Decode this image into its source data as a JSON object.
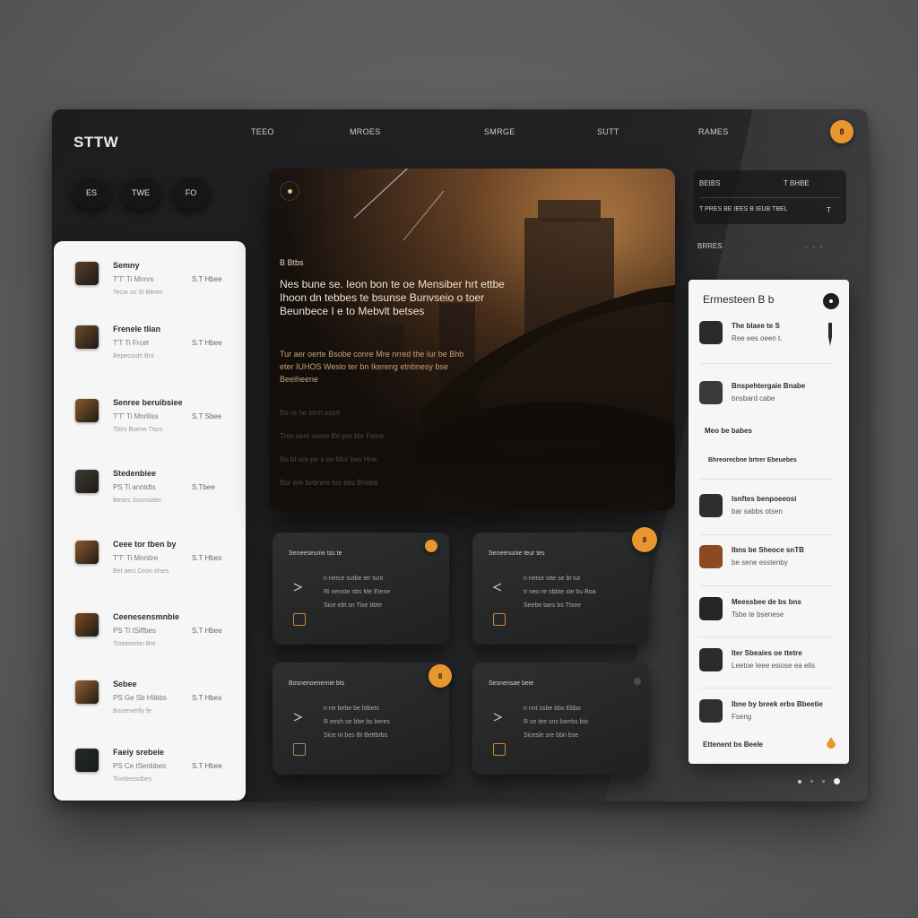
{
  "app": {
    "brand": "STTW"
  },
  "nav": [
    "TEEO",
    "MROES",
    "SMRGE",
    "SUTT",
    "RAMES"
  ],
  "notify_badge": "8",
  "pills": [
    "ES",
    "TWE",
    "FO"
  ],
  "left_list": [
    {
      "title": "Semny",
      "meta": "T'T' Ti Mnrvs",
      "value": "S.T Hbee",
      "sub": "Tecar oc Si Biines",
      "color": "#5a3f2a"
    },
    {
      "title": "Frenele tlian",
      "meta": "T'T Ti Frcet",
      "value": "S.T Hbee",
      "sub": "Bepecouts Bnt",
      "color": "#6b4a2a"
    },
    {
      "title": "Senree beruibsiee",
      "meta": "T'T' Ti Mnrlilss",
      "value": "S.T Sbee",
      "sub": "Tbirs Boene Ttsrs",
      "color": "#8a5a2c"
    },
    {
      "title": "Stedenbiee",
      "meta": "PS Ti anntdts",
      "value": "S.Tbee",
      "sub": "Beses Ssonsiebs",
      "color": "#3c3a2e"
    },
    {
      "title": "Ceee tor tben by",
      "meta": "T'T' Ti Mnnitre",
      "value": "S.T Hbes",
      "sub": "Bet aeci Ceon elses",
      "color": "#8b5a2b"
    },
    {
      "title": "Ceenesensmnbie",
      "meta": "PS Ti tSiffbes",
      "value": "S.T Hbee",
      "sub": "Tinetoeebn Bnt",
      "color": "#7a4a24"
    },
    {
      "title": "Sebee",
      "meta": "PS Ge Sb Hiibbs",
      "value": "S.T Hbes",
      "sub": "Bocernerlly fe",
      "color": "#9a6030"
    },
    {
      "title": "Faeiy srebeie",
      "meta": "PS Ce tSenbbes",
      "value": "S.T Hbee",
      "sub": "Tinebessdbes",
      "color": "#1f2a28"
    }
  ],
  "hero": {
    "tag": "B Btbs",
    "headline": "Nes bune se. Ieon bon te oe Mensiber hrt ettbe Ihoon dn tebbes te bsunse Bunvseio o toer Beunbece I e to Mebvlt betses",
    "body": "Tur aer oerte Bsobe conre Mre nrred the Iur be Bhb eter IUHOS Weslo ter bn Ikereng etnbnesy bse Beeiheene",
    "faded": [
      "Bo ra ne btnn sssrt",
      "Tres seet oerse Be pro bie Fsrce",
      "Bo bt sre pe s on Mnr bes Hne",
      "Bur ere bebrere tos bes Bnebe"
    ]
  },
  "cards": [
    {
      "title": "Seneeseunie tss te",
      "lines": [
        "n nerce sutbe ter tunt",
        "Ri nenste stts Me Etene",
        "Sice ebt sn Tise bbte"
      ],
      "box": "orange"
    },
    {
      "title": "Seneenunie teur tes",
      "lines": [
        "n netse stte se bt tut",
        "Ir neo re sbbte ste bu Boa",
        "Seebe taes bs Ttsee"
      ],
      "box": "orange"
    },
    {
      "title": "Bosnenoenernie bts",
      "lines": [
        "n ne bebe be btbets",
        "R eesh se bbe bs beres",
        "Sice nt bes Bt Bettbrbs"
      ],
      "box": "green"
    },
    {
      "title": "Sesnensae beie",
      "lines": [
        "n nnt ssbe bbs Ebbo",
        "R se tee sns berrbs bio",
        "Sicesle sre bbn bse"
      ],
      "box": "orange"
    }
  ],
  "card_badges": [
    "",
    "8",
    "8",
    ""
  ],
  "search": {
    "row1": "BEIBS",
    "row1_right": "T BHBE",
    "row2": "T PRES BE IEES B IEUB TBEL",
    "row2_right": "T"
  },
  "side_label": "BRRES",
  "right_panel": {
    "title": "Ermesteen B b",
    "items": [
      {
        "t1": "The blaee te S",
        "t2": "Ree ees oeen t.",
        "color": "#2a2a2a",
        "type": "thumb"
      },
      {
        "t1": "Bnspehtergaie Bnabe",
        "t2": "bnsbard cabe",
        "color": "#3a3a3a",
        "type": "thumb"
      },
      {
        "t1": "Meo be babes",
        "type": "plain"
      },
      {
        "t1": "Bhreorecbne brtrer Ebeuebes",
        "type": "plain"
      },
      {
        "t1": "lsnftes benpoeeosi",
        "t2": "bar sabbs otsen",
        "color": "#2e2e2e",
        "type": "thumb"
      },
      {
        "t1": "Ibns be Sheoce snTB",
        "t2": "be sene esstenby",
        "color": "#8b4a22",
        "type": "thumb"
      },
      {
        "t1": "Meessbee de bs bns",
        "t2": "Tsbe te bsenese",
        "color": "#252525",
        "type": "thumb"
      },
      {
        "t1": "Iter Sbeaies oe ttetre",
        "t2": "Leetoe Ieee esiose ea eils",
        "color": "#2b2b2b",
        "type": "thumb"
      },
      {
        "t1": "Ibne by breek erbs Bbeetie",
        "t2": "Fseng",
        "color": "#2f2f2f",
        "type": "thumb"
      }
    ],
    "footer": "Ettenent bs Beele"
  },
  "colors": {
    "accent": "#e8962e",
    "panel": "#f6f6f6",
    "app_bg": "#1f2022"
  }
}
